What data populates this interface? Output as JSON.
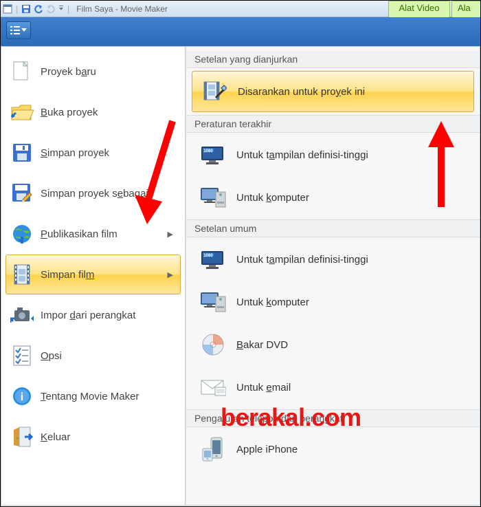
{
  "titlebar": {
    "app_title": "Film Saya - Movie Maker"
  },
  "tool_tabs": {
    "a": "Alat Video",
    "b": "Ala"
  },
  "left_menu": [
    {
      "label": "Proyek baru",
      "key_index": 8,
      "icon": "doc-new"
    },
    {
      "label": "Buka proyek",
      "key_index": 0,
      "icon": "folder-open"
    },
    {
      "label": "Simpan proyek",
      "key_index": 0,
      "icon": "disk"
    },
    {
      "label": "Simpan proyek sebagai",
      "key_index": 15,
      "icon": "disk-pencil"
    },
    {
      "label": "Publikasikan film",
      "key_index": 0,
      "icon": "globe",
      "has_arrow": true
    },
    {
      "label": "Simpan film",
      "key_index": 10,
      "icon": "film",
      "has_arrow": true,
      "selected": true
    },
    {
      "label": "Impor dari perangkat",
      "key_index": 6,
      "icon": "camera-import"
    },
    {
      "label": "Opsi",
      "key_index": 0,
      "icon": "checklist"
    },
    {
      "label": "Tentang Movie Maker",
      "key_index": 0,
      "icon": "info"
    },
    {
      "label": "Keluar",
      "key_index": 0,
      "icon": "door-exit"
    }
  ],
  "right_sections": [
    {
      "header": "Setelan yang dianjurkan",
      "items": [
        {
          "label": "Disarankan untuk proyek ini",
          "key_index": 20,
          "icon": "film-wand",
          "highlight": true
        }
      ]
    },
    {
      "header": "Peraturan terakhir",
      "items": [
        {
          "label": "Untuk tampilan definisi-tinggi",
          "key_index": 7,
          "icon": "monitor-1080"
        },
        {
          "label": "Untuk komputer",
          "key_index": 6,
          "icon": "monitor-pc"
        }
      ]
    },
    {
      "header": "Setelan umum",
      "items": [
        {
          "label": "Untuk tampilan definisi-tinggi",
          "key_index": 7,
          "icon": "monitor-1080"
        },
        {
          "label": "Untuk komputer",
          "key_index": 6,
          "icon": "monitor-pc"
        },
        {
          "label": "Bakar DVD",
          "key_index": 0,
          "icon": "dvd"
        },
        {
          "label": "Untuk email",
          "key_index": 6,
          "icon": "mail"
        }
      ]
    },
    {
      "header": "Pengaturan telepon dan perangkat",
      "items": [
        {
          "label": "Apple iPhone",
          "key_index": -1,
          "icon": "iphone"
        }
      ]
    }
  ],
  "watermark": "berakal.com"
}
